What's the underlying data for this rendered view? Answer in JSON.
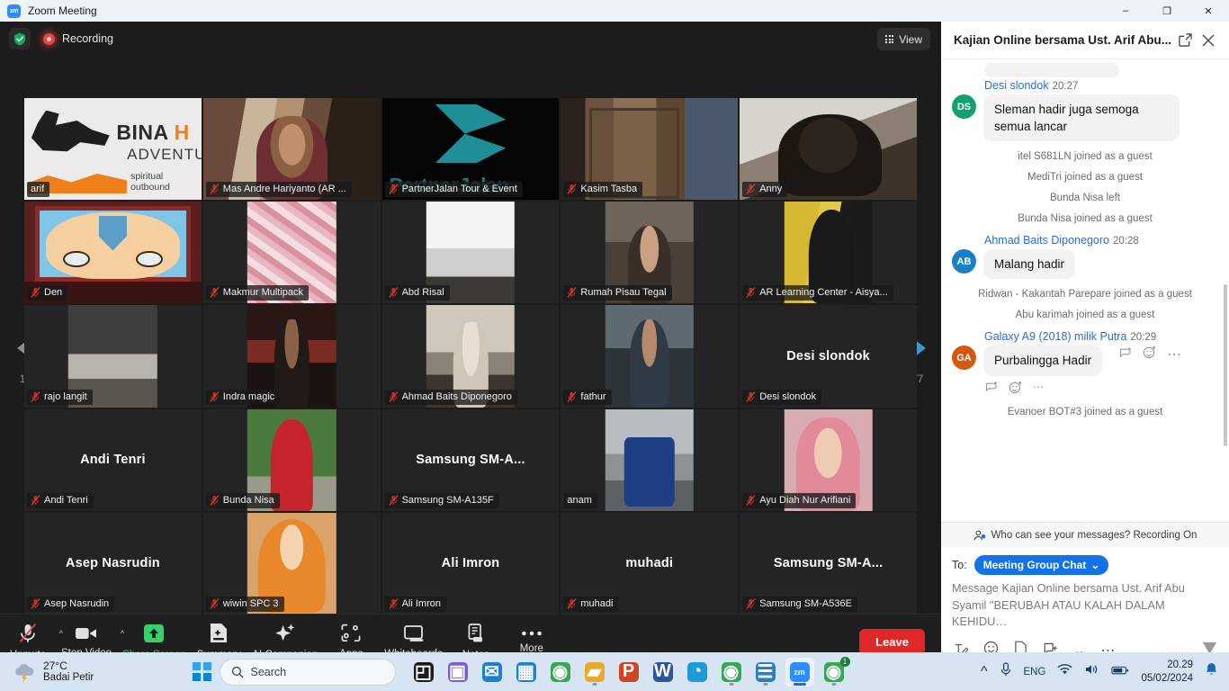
{
  "window": {
    "app_name": "Zoom Meeting",
    "logo_text": "zm",
    "minimize": "–",
    "maximize": "❐",
    "close": "✕"
  },
  "meeting_top": {
    "recording_label": "Recording",
    "view_label": "View"
  },
  "pagination": {
    "left_indicator": "1/7",
    "right_indicator": "1/7"
  },
  "participants": [
    {
      "name": "arif",
      "center_name": "",
      "active": true,
      "muted": false,
      "video": "bina"
    },
    {
      "name": "Mas Andre Hariyanto (AR ...",
      "center_name": "",
      "active": false,
      "muted": true,
      "video": "photo1"
    },
    {
      "name": "PartnerJalan Tour & Event",
      "center_name": "",
      "active": false,
      "muted": true,
      "video": "partner"
    },
    {
      "name": "Kasim Tasba",
      "center_name": "",
      "active": false,
      "muted": true,
      "video": "door"
    },
    {
      "name": "Anny",
      "center_name": "",
      "active": false,
      "muted": true,
      "video": "anny"
    },
    {
      "name": "Den",
      "center_name": "",
      "active": false,
      "muted": true,
      "video": "avatar"
    },
    {
      "name": "Makmur Multipack",
      "center_name": "",
      "active": false,
      "muted": true,
      "video": "boxes",
      "thumb": true
    },
    {
      "name": "Abd Risal",
      "center_name": "",
      "active": false,
      "muted": true,
      "video": "white",
      "thumb": true
    },
    {
      "name": "Rumah Pisau Tegal",
      "center_name": "",
      "active": false,
      "muted": true,
      "video": "pisau",
      "thumb": true
    },
    {
      "name": "AR Learning Center - Aisya...",
      "center_name": "",
      "active": false,
      "muted": true,
      "video": "aisya",
      "thumb": true
    },
    {
      "name": "rajo langit",
      "center_name": "",
      "active": false,
      "muted": true,
      "video": "rajo",
      "thumb": true
    },
    {
      "name": "Indra magic",
      "center_name": "",
      "active": false,
      "muted": true,
      "video": "indra",
      "thumb": true
    },
    {
      "name": "Ahmad Baits Diponegoro",
      "center_name": "",
      "active": false,
      "muted": true,
      "video": "ahmad",
      "thumb": true
    },
    {
      "name": "fathur",
      "center_name": "",
      "active": false,
      "muted": true,
      "video": "fathur",
      "thumb": true
    },
    {
      "name": "Desi slondok",
      "center_name": "Desi slondok",
      "active": false,
      "muted": true,
      "video": ""
    },
    {
      "name": "Andi Tenri",
      "center_name": "Andi Tenri",
      "active": false,
      "muted": true,
      "video": ""
    },
    {
      "name": "Bunda Nisa",
      "center_name": "",
      "active": false,
      "muted": true,
      "video": "bunda",
      "thumb": true
    },
    {
      "name": "Samsung SM-A135F",
      "center_name": "Samsung  SM-A...",
      "active": false,
      "muted": true,
      "video": ""
    },
    {
      "name": "anam",
      "center_name": "",
      "active": false,
      "muted": false,
      "video": "anam",
      "thumb": true
    },
    {
      "name": "Ayu Diah Nur Arifiani",
      "center_name": "",
      "active": false,
      "muted": true,
      "video": "ayu",
      "thumb": true
    },
    {
      "name": "Asep Nasrudin",
      "center_name": "Asep Nasrudin",
      "active": false,
      "muted": true,
      "video": ""
    },
    {
      "name": "wiwin SPC 3",
      "center_name": "",
      "active": false,
      "muted": true,
      "video": "wiwin",
      "thumb": true
    },
    {
      "name": "Ali Imron",
      "center_name": "Ali Imron",
      "active": false,
      "muted": true,
      "video": ""
    },
    {
      "name": "muhadi",
      "center_name": "muhadi",
      "active": false,
      "muted": true,
      "video": ""
    },
    {
      "name": "Samsung SM-A536E",
      "center_name": "Samsung  SM-A...",
      "active": false,
      "muted": true,
      "video": ""
    }
  ],
  "toolbar": {
    "items": [
      {
        "label": "Unmute",
        "icon": "mic-off-icon",
        "has_caret": true,
        "accent": false
      },
      {
        "label": "Stop Video",
        "icon": "video-icon",
        "has_caret": true,
        "accent": false
      },
      {
        "label": "Share Screen",
        "icon": "share-screen-icon",
        "has_caret": false,
        "accent": true
      },
      {
        "label": "Summary",
        "icon": "summary-icon",
        "has_caret": false,
        "accent": false
      },
      {
        "label": "AI Companion",
        "icon": "ai-sparkle-icon",
        "has_caret": false,
        "accent": false
      },
      {
        "label": "Apps",
        "icon": "apps-icon",
        "has_caret": false,
        "accent": false
      },
      {
        "label": "Whiteboards",
        "icon": "whiteboard-icon",
        "has_caret": false,
        "accent": false
      },
      {
        "label": "Notes",
        "icon": "notes-icon",
        "has_caret": false,
        "accent": false
      },
      {
        "label": "More",
        "icon": "more-dots-icon",
        "has_caret": false,
        "accent": false
      }
    ],
    "leave_label": "Leave",
    "accent_color": "#38d06c",
    "leave_color": "#e02828"
  },
  "chat": {
    "title": "Kajian Online bersama Ust. Arif Abu...",
    "messages": [
      {
        "kind": "partial"
      },
      {
        "kind": "message",
        "sender": "Desi slondok",
        "time": "20:27",
        "initials": "DS",
        "avatar_color": "#14a06a",
        "text": "Sleman hadir juga semoga semua lancar",
        "reactions": false
      },
      {
        "kind": "system",
        "text": "itel S681LN joined as a guest"
      },
      {
        "kind": "system",
        "text": "MediTri joined as a guest"
      },
      {
        "kind": "system",
        "text": "Bunda Nisa left"
      },
      {
        "kind": "system",
        "text": "Bunda Nisa joined as a guest"
      },
      {
        "kind": "message",
        "sender": "Ahmad Baits Diponegoro",
        "time": "20:28",
        "initials": "AB",
        "avatar_color": "#1b7fc4",
        "text": "Malang hadir",
        "reactions": false
      },
      {
        "kind": "system",
        "text": "Ridwan - Kakantah Parepare joined as a guest"
      },
      {
        "kind": "system",
        "text": "Abu karimah joined as a guest"
      },
      {
        "kind": "message",
        "sender": "Galaxy A9 (2018) milik Putra",
        "time": "20:29",
        "initials": "GA",
        "avatar_color": "#d4590c",
        "text": "Purbalingga Hadir",
        "reactions": true
      },
      {
        "kind": "system",
        "text": "Evanoer BOT#3 joined as a guest"
      }
    ],
    "privacy_note": "Who can see your messages? Recording On",
    "to_label": "To:",
    "to_value": "Meeting Group Chat",
    "compose_placeholder": "Message Kajian Online bersama Ust. Arif Abu Syamil \"BERUBAH ATAU KALAH DALAM KEHIDU…"
  },
  "taskbar": {
    "weather_temp": "27°C",
    "weather_desc": "Badai Petir",
    "search_placeholder": "Search",
    "apps": [
      {
        "name": "file-explorer-dark-icon",
        "glyph": "◰",
        "color": "#1b1b1b",
        "active": false,
        "running": false
      },
      {
        "name": "zoom-workplace-icon",
        "glyph": "▣",
        "color": "#7a5cd6",
        "active": false,
        "running": false
      },
      {
        "name": "mail-icon",
        "glyph": "✉",
        "color": "#1d7fd4",
        "active": false,
        "running": false
      },
      {
        "name": "calendar-icon",
        "glyph": "▦",
        "color": "#1d7fd4",
        "active": false,
        "running": false
      },
      {
        "name": "chrome-icon",
        "glyph": "◉",
        "color": "#34a853",
        "active": false,
        "running": false
      },
      {
        "name": "file-explorer-icon",
        "glyph": "▰",
        "color": "#e8a92b",
        "active": false,
        "running": true
      },
      {
        "name": "powerpoint-icon",
        "glyph": "P",
        "color": "#d04423",
        "active": false,
        "running": false
      },
      {
        "name": "word-icon",
        "glyph": "W",
        "color": "#2b579a",
        "active": false,
        "running": false
      },
      {
        "name": "edge-icon",
        "glyph": "◔",
        "color": "#1e9ad6",
        "active": false,
        "running": false
      },
      {
        "name": "chrome-profile-icon",
        "glyph": "◉",
        "color": "#34a853",
        "active": false,
        "running": true
      },
      {
        "name": "notepad-icon",
        "glyph": "☰",
        "color": "#2a7fbe",
        "active": false,
        "running": true
      },
      {
        "name": "zoom-meeting-icon",
        "glyph": "zm",
        "color": "#2d8cff",
        "active": true,
        "running": true
      },
      {
        "name": "chrome-badge-icon",
        "glyph": "◉",
        "color": "#34a853",
        "active": false,
        "running": true,
        "badge": "1"
      }
    ],
    "language": "ENG",
    "time": "20.29",
    "date": "05/02/2024"
  }
}
